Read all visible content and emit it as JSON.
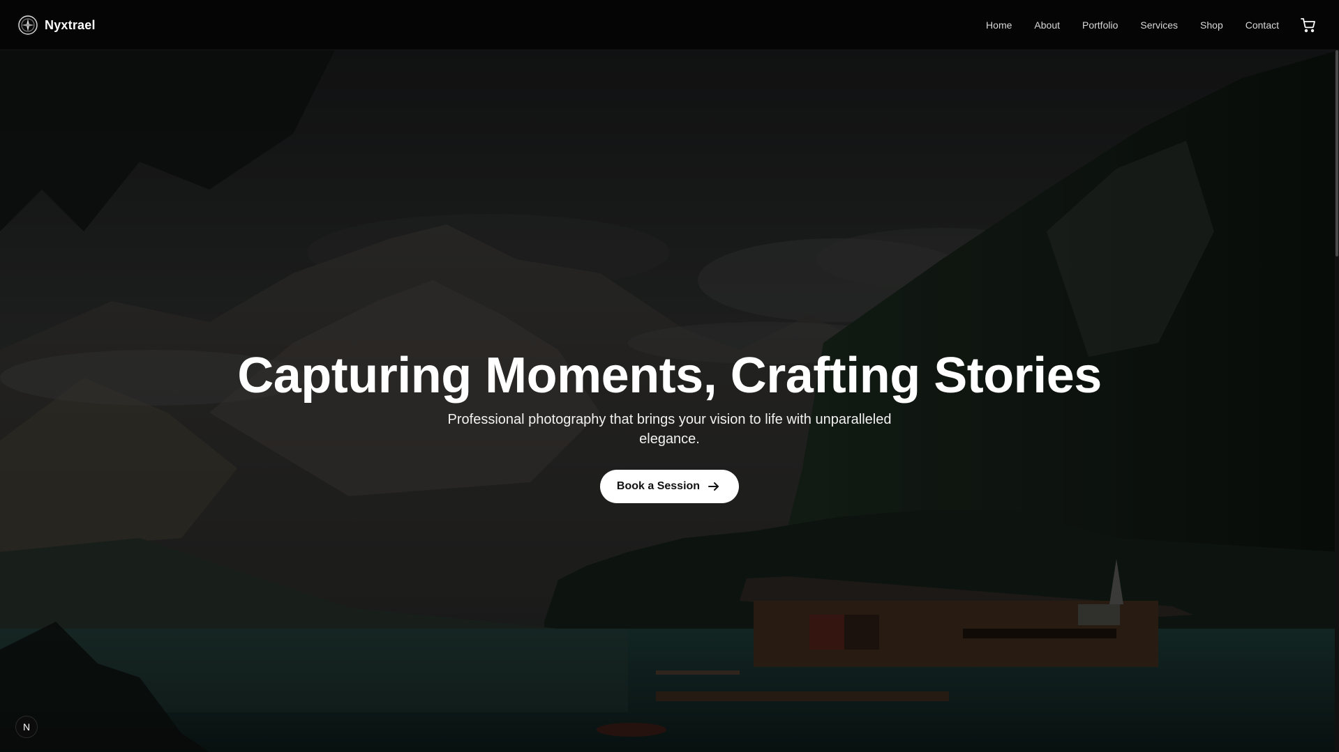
{
  "header": {
    "brand_name": "Nyxtrael",
    "nav": [
      {
        "label": "Home"
      },
      {
        "label": "About"
      },
      {
        "label": "Portfolio"
      },
      {
        "label": "Services"
      },
      {
        "label": "Shop"
      },
      {
        "label": "Contact"
      }
    ],
    "cart_icon": "shopping-cart-icon",
    "logo_icon": "compass-logo-icon"
  },
  "hero": {
    "title": "Capturing Moments, Crafting Stories",
    "subtitle": "Professional photography that brings your vision to life with unparalleled elegance.",
    "cta_label": "Book a Session",
    "cta_icon": "arrow-right-icon",
    "background": "mountain-lake-cabin-photo"
  },
  "badge": {
    "label": "N"
  },
  "colors": {
    "nav_background": "#050505",
    "text": "#ffffff",
    "cta_background": "#ffffff",
    "cta_text": "#111111"
  }
}
